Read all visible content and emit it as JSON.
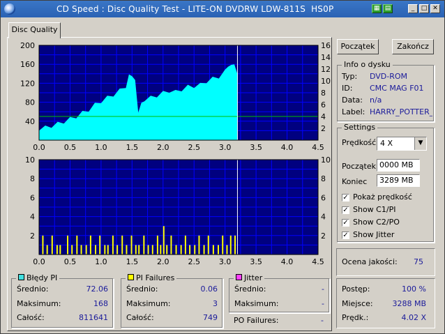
{
  "window": {
    "title": "CD Speed : Disc Quality Test - LITE-ON DVDRW LDW-811S  HS0P"
  },
  "tabs": [
    {
      "label": "Disc Quality",
      "active": true
    }
  ],
  "buttons": {
    "start": "Początek",
    "finish": "Zakończ"
  },
  "disc_info": {
    "legend": "Info o dysku",
    "rows": [
      {
        "label": "Typ:",
        "value": "DVD-ROM"
      },
      {
        "label": "ID:",
        "value": "CMC MAG F01"
      },
      {
        "label": "Data:",
        "value": "n/a"
      },
      {
        "label": "Label:",
        "value": "HARRY_POTTER_"
      }
    ]
  },
  "settings": {
    "legend": "Settings",
    "speed_label": "Prędkość",
    "speed_value": "4 X",
    "start_label": "Początek",
    "start_value": "0000 MB",
    "end_label": "Koniec",
    "end_value": "3289 MB",
    "checkboxes": [
      {
        "label": "Pokaż prędkość",
        "checked": true
      },
      {
        "label": "Show C1/PI",
        "checked": true
      },
      {
        "label": "Show C2/PO",
        "checked": true
      },
      {
        "label": "Show Jitter",
        "checked": true
      }
    ]
  },
  "quality": {
    "label": "Ocena jakości:",
    "value": "75"
  },
  "progress": {
    "rows": [
      {
        "label": "Postęp:",
        "value": "100 %"
      },
      {
        "label": "Miejsce:",
        "value": "3288 MB"
      },
      {
        "label": "Prędk.:",
        "value": "4.02 X"
      }
    ]
  },
  "stats": {
    "pi_errors": {
      "legend": "Błędy PI",
      "color": "#40e0e0",
      "rows": [
        {
          "label": "Średnio:",
          "value": "72.06"
        },
        {
          "label": "Maksimum:",
          "value": "168"
        },
        {
          "label": "Całość:",
          "value": "811641"
        }
      ]
    },
    "pi_failures": {
      "legend": "PI Failures",
      "color": "#ffff00",
      "rows": [
        {
          "label": "Średnio:",
          "value": "0.06"
        },
        {
          "label": "Maksimum:",
          "value": "3"
        },
        {
          "label": "Całość:",
          "value": "749"
        }
      ]
    },
    "jitter": {
      "legend": "Jitter",
      "color": "#ff40ff",
      "rows": [
        {
          "label": "Średnio:",
          "value": "-"
        },
        {
          "label": "Maksimum:",
          "value": "-"
        }
      ]
    },
    "po_failures": {
      "label": "PO Failures:",
      "value": "-"
    }
  },
  "colors": {
    "plot_bg": "#000080",
    "grid": "#0000ff",
    "pi_fill": "#00ffff",
    "speed_line": "#00c000",
    "failures": "#ffff00",
    "marker": "#ffffff"
  },
  "chart_data": [
    {
      "type": "area",
      "name": "PI errors",
      "x_unit": "GB",
      "xlim": [
        0,
        4.5
      ],
      "ylim": [
        0,
        200
      ],
      "ylim_right": [
        0,
        16
      ],
      "x_ticks": [
        "0.0",
        "0.5",
        "1.0",
        "1.5",
        "2.0",
        "2.5",
        "3.0",
        "3.5",
        "4.0",
        "4.5"
      ],
      "y_ticks": [
        "40",
        "80",
        "120",
        "160",
        "200"
      ],
      "y_ticks_right": [
        "2",
        "4",
        "6",
        "8",
        "10",
        "12",
        "14",
        "16"
      ],
      "grid": true,
      "end_position": 3.2,
      "series": [
        {
          "values_note": "PI error envelope per position",
          "x": [
            0.0,
            0.1,
            0.2,
            0.3,
            0.4,
            0.5,
            0.6,
            0.7,
            0.8,
            0.9,
            1.0,
            1.1,
            1.2,
            1.3,
            1.4,
            1.45,
            1.5,
            1.55,
            1.6,
            1.65,
            1.7,
            1.8,
            1.9,
            2.0,
            2.1,
            2.2,
            2.3,
            2.4,
            2.5,
            2.6,
            2.7,
            2.8,
            2.9,
            3.0,
            3.05,
            3.1,
            3.15,
            3.2
          ],
          "y": [
            20,
            22,
            26,
            30,
            35,
            40,
            46,
            53,
            60,
            70,
            78,
            85,
            92,
            100,
            110,
            130,
            135,
            118,
            58,
            70,
            82,
            85,
            90,
            95,
            100,
            97,
            103,
            108,
            110,
            112,
            120,
            125,
            130,
            140,
            155,
            150,
            160,
            130
          ]
        }
      ],
      "speed_line": {
        "x": [
          0.0,
          3.2
        ],
        "y": [
          4.0,
          4.0
        ]
      }
    },
    {
      "type": "bar",
      "name": "PI failures",
      "x_unit": "GB",
      "xlim": [
        0,
        4.5
      ],
      "ylim": [
        0,
        10
      ],
      "ylim_right": [
        0,
        10
      ],
      "x_ticks": [
        "0.0",
        "0.5",
        "1.0",
        "1.5",
        "2.0",
        "2.5",
        "3.0",
        "3.5",
        "4.0",
        "4.5"
      ],
      "y_ticks": [
        "2",
        "4",
        "6",
        "8",
        "10"
      ],
      "y_ticks_right": [
        "2",
        "4",
        "6",
        "8",
        "10"
      ],
      "grid": true,
      "end_position": 3.2,
      "x": [
        0.05,
        0.12,
        0.2,
        0.28,
        0.33,
        0.45,
        0.52,
        0.6,
        0.67,
        0.75,
        0.82,
        0.9,
        0.97,
        1.05,
        1.1,
        1.18,
        1.25,
        1.33,
        1.4,
        1.48,
        1.55,
        1.6,
        1.68,
        1.75,
        1.82,
        1.9,
        1.95,
        2.0,
        2.05,
        2.12,
        2.2,
        2.28,
        2.35,
        2.42,
        2.5,
        2.57,
        2.65,
        2.72,
        2.8,
        2.88,
        2.95,
        3.02,
        3.08,
        3.15
      ],
      "values": [
        2,
        1,
        2,
        1,
        1,
        2,
        1,
        2,
        1,
        1,
        2,
        1,
        2,
        1,
        1,
        2,
        1,
        2,
        1,
        2,
        1,
        1,
        2,
        1,
        1,
        2,
        1,
        3,
        1,
        2,
        1,
        1,
        2,
        1,
        1,
        2,
        1,
        2,
        1,
        1,
        2,
        1,
        2,
        2
      ]
    }
  ]
}
